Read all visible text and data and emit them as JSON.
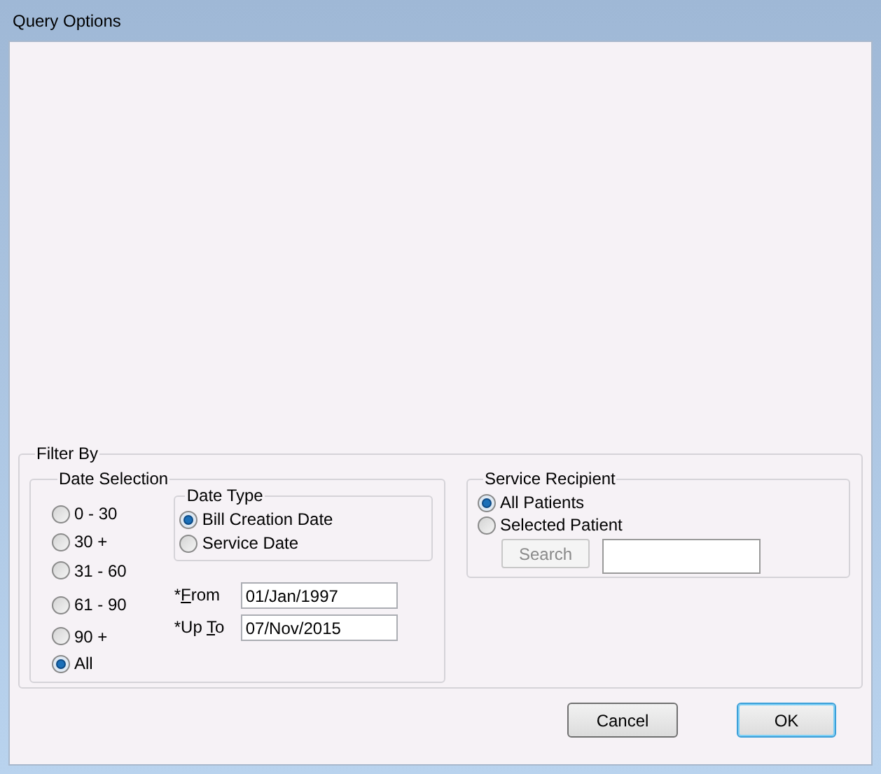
{
  "window": {
    "title": "Query Options"
  },
  "filter_by": {
    "title": "Filter By",
    "date_selection": {
      "title": "Date Selection",
      "options": [
        {
          "label": "0 - 30",
          "selected": false
        },
        {
          "label": "30 +",
          "selected": false
        },
        {
          "label": "31 - 60",
          "selected": false
        },
        {
          "label": "61 - 90",
          "selected": false
        },
        {
          "label": "90 +",
          "selected": false
        },
        {
          "label": "All",
          "selected": true
        }
      ]
    },
    "date_type": {
      "title": "Date Type",
      "options": [
        {
          "label": "Bill Creation Date",
          "selected": true
        },
        {
          "label": "Service Date",
          "selected": false
        }
      ]
    },
    "from": {
      "label": {
        "before": "*",
        "key": "F",
        "after": "rom"
      },
      "value": "01/Jan/1997"
    },
    "up_to": {
      "label": {
        "before": "*Up ",
        "key": "T",
        "after": "o"
      },
      "value": "07/Nov/2015"
    },
    "service_recipient": {
      "title": "Service Recipient",
      "options": [
        {
          "label": "All Patients",
          "selected": true
        },
        {
          "label": "Selected Patient",
          "selected": false
        }
      ],
      "search_button": {
        "label": "Search",
        "disabled": true
      }
    }
  },
  "buttons": [
    {
      "label": "Cancel",
      "default": false
    },
    {
      "label": "OK",
      "default": true
    }
  ]
}
